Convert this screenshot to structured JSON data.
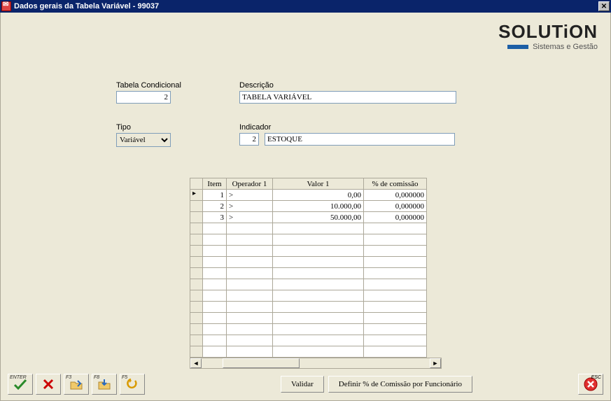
{
  "window": {
    "title": "Dados gerais da Tabela Variável - 99037"
  },
  "brand": {
    "name": "SOLUTiON",
    "tagline": "Sistemas e Gestão"
  },
  "fields": {
    "tabcond": {
      "label": "Tabela Condicional",
      "value": "2"
    },
    "descricao": {
      "label": "Descrição",
      "value": "TABELA VARIÁVEL"
    },
    "tipo": {
      "label": "Tipo",
      "value": "Variável"
    },
    "indicador": {
      "label": "Indicador",
      "num": "2",
      "text": "ESTOQUE"
    }
  },
  "grid": {
    "headers": {
      "item": "Item",
      "operador": "Operador 1",
      "valor1": "Valor 1",
      "comissao": "% de comissão"
    },
    "rows": [
      {
        "item": "1",
        "op": ">",
        "v1": "0,00",
        "com": "0,000000"
      },
      {
        "item": "2",
        "op": ">",
        "v1": "10.000,00",
        "com": "0,000000"
      },
      {
        "item": "3",
        "op": ">",
        "v1": "50.000,00",
        "com": "0,000000"
      }
    ],
    "blank_rows": 12
  },
  "buttons": {
    "enter": "ENTER",
    "f3": "F3",
    "f8": "F8",
    "f5": "F5",
    "esc": "ESC",
    "validar": "Validar",
    "definir": "Definir % de Comissão por Funcionário"
  }
}
